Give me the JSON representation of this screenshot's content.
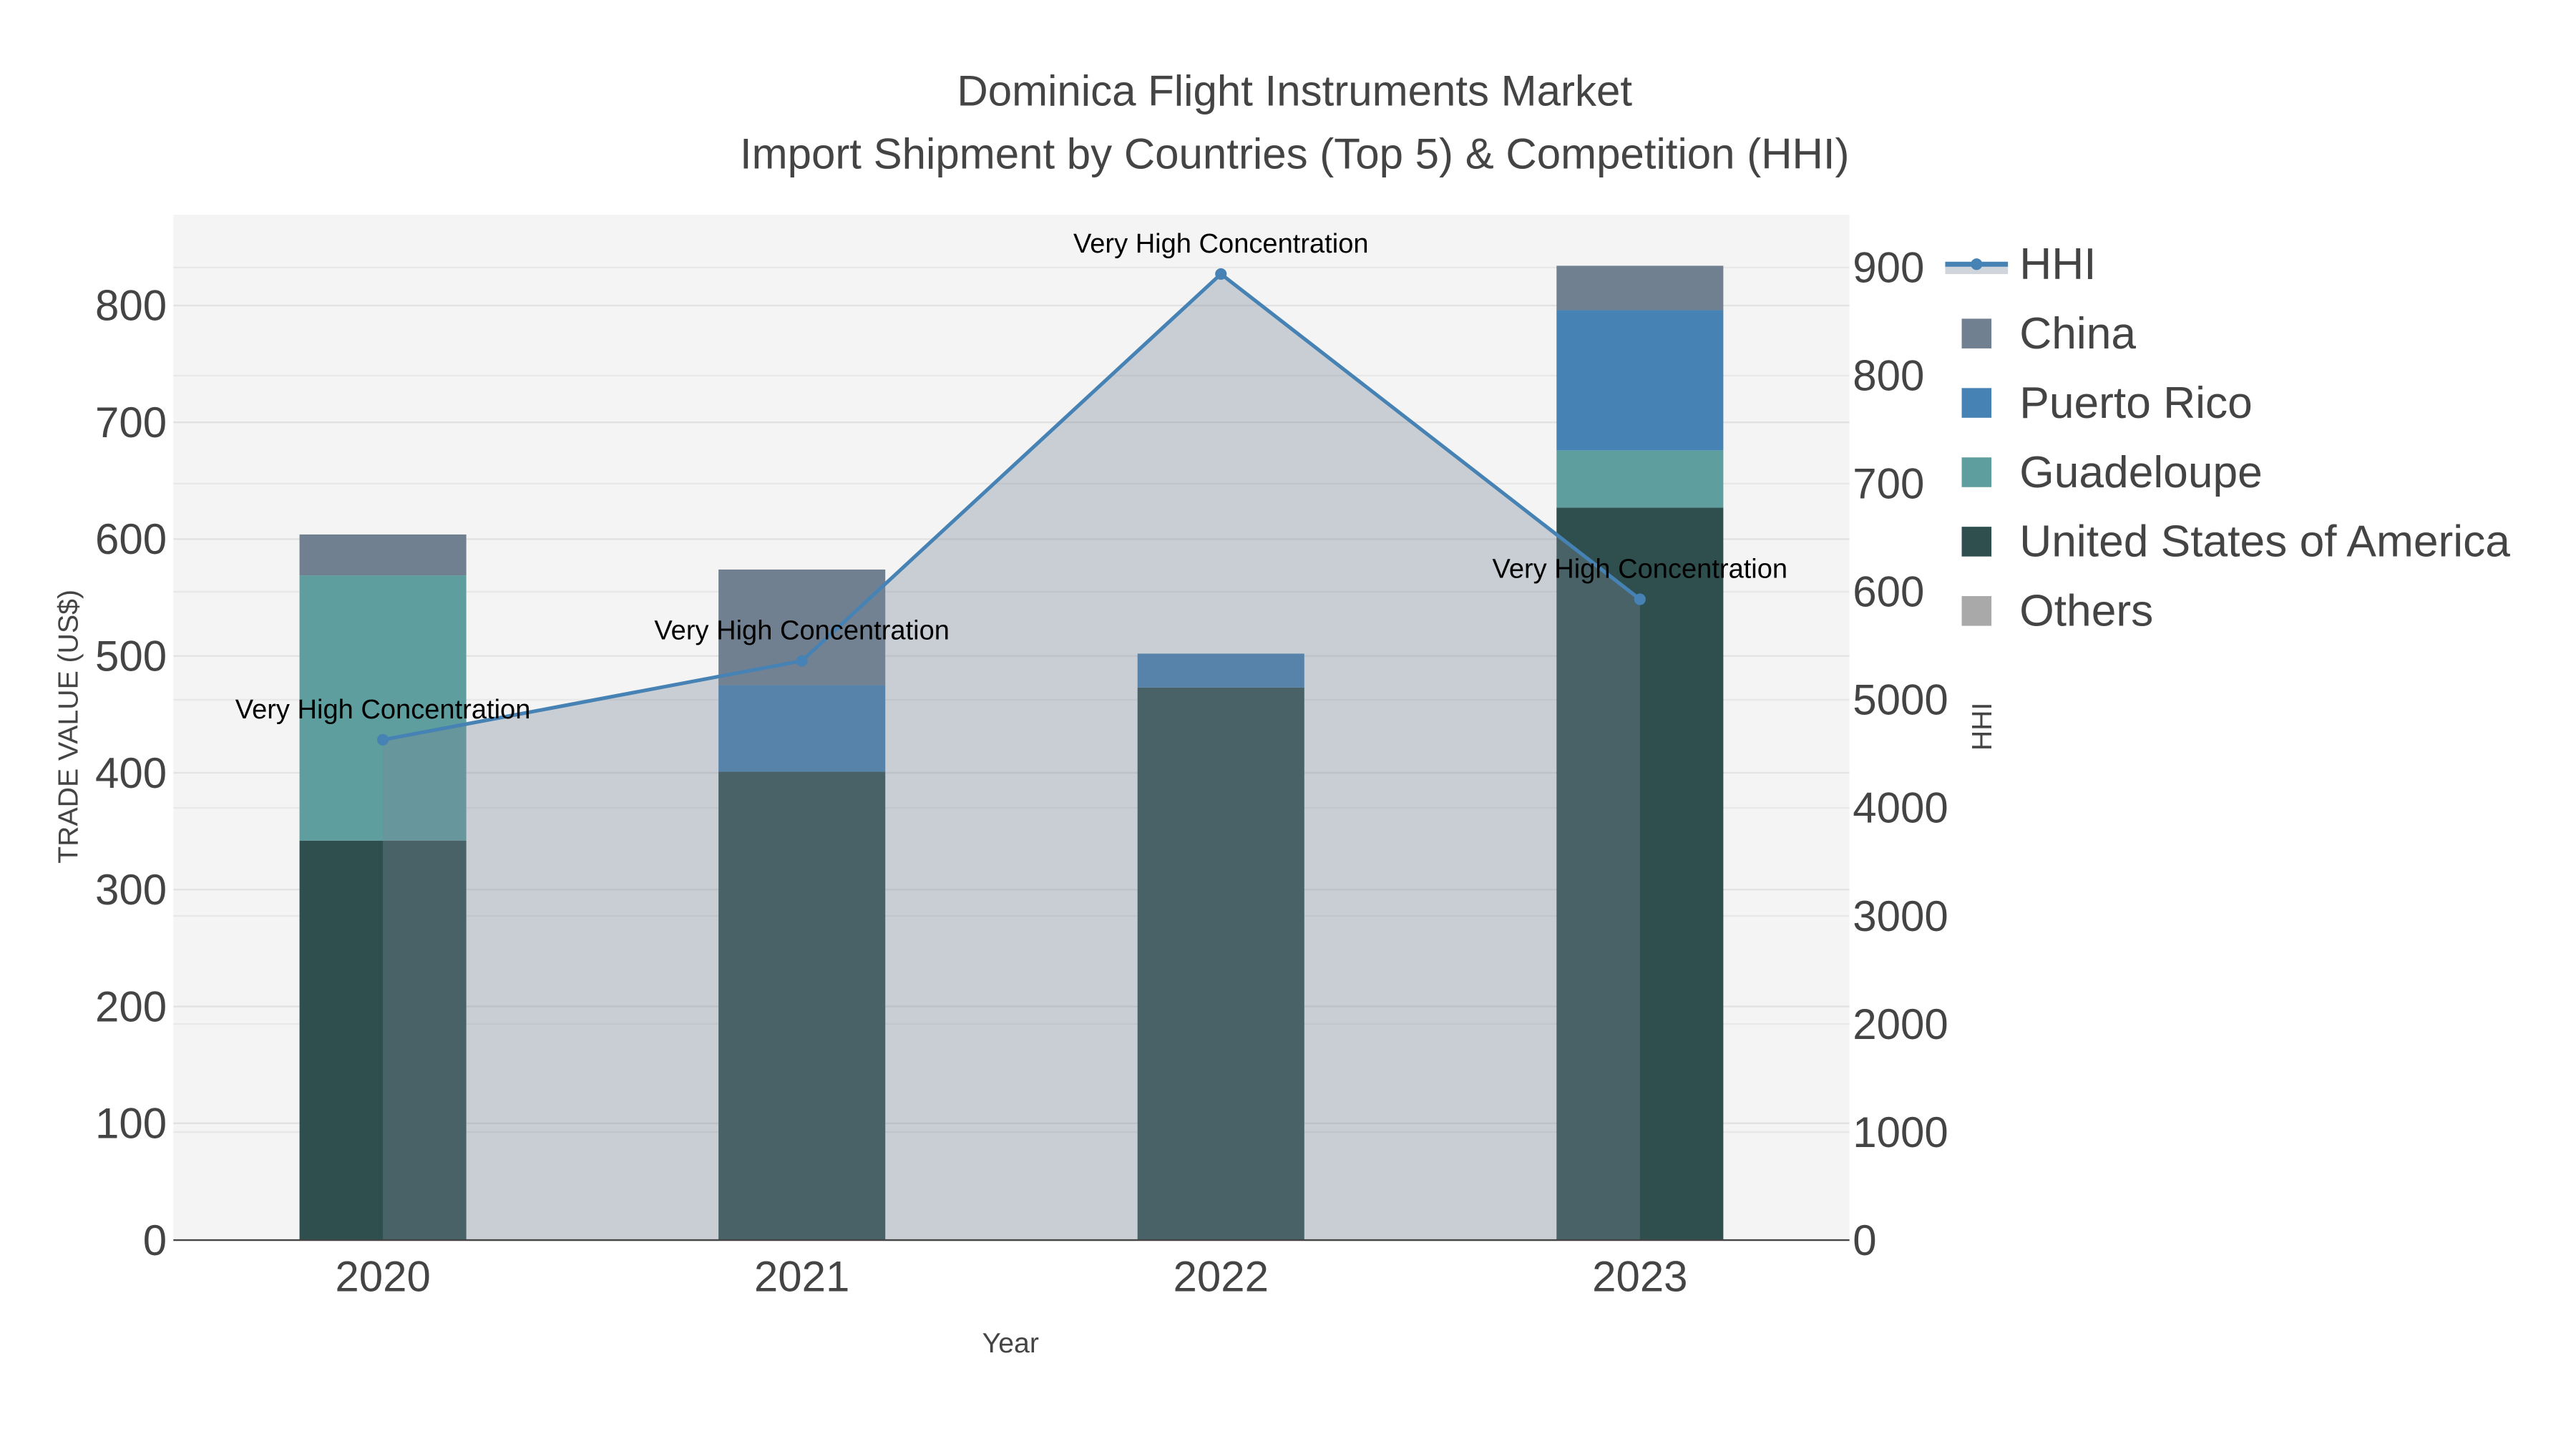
{
  "chart_data": {
    "type": "bar",
    "title": "Dominica Flight Instruments Market",
    "subtitle": "Import Shipment by Countries (Top 5) & Competition (HHI)",
    "xlabel": "Year",
    "ylabel": "TRADE VALUE (US$)",
    "y2label": "HHI",
    "categories": [
      "2020",
      "2021",
      "2022",
      "2023"
    ],
    "ylim": [
      0,
      875
    ],
    "y2lim": [
      0,
      9800
    ],
    "yticks": [
      0,
      100,
      200,
      300,
      400,
      500,
      600,
      700,
      800
    ],
    "y2ticks": [
      0,
      1000,
      2000,
      3000,
      4000,
      5000,
      6000,
      7000,
      8000,
      9000
    ],
    "y2tick_labels": [
      "0",
      "1000",
      "2000",
      "3000",
      "4000",
      "5000",
      "600",
      "700",
      "800",
      "900"
    ],
    "barmode": "stack",
    "series": [
      {
        "name": "United States of America",
        "color": "#2f4f4f",
        "values": [
          342,
          401,
          473,
          627
        ]
      },
      {
        "name": "Guadeloupe",
        "color": "#5f9e9e",
        "values": [
          227,
          0,
          0,
          49
        ]
      },
      {
        "name": "Puerto Rico",
        "color": "#4682b4",
        "values": [
          0,
          74,
          29,
          120
        ]
      },
      {
        "name": "China",
        "color": "#708090",
        "values": [
          35,
          99,
          0,
          38
        ]
      },
      {
        "name": "Others",
        "color": "#a9a9a9",
        "values": [
          0,
          0,
          0,
          0
        ]
      }
    ],
    "hhi": {
      "name": "HHI",
      "color": "#4682b4",
      "values": [
        4630,
        5360,
        8940,
        5930
      ],
      "annotations": [
        "Very High Concentration",
        "Very High Concentration",
        "Very High Concentration",
        "Very High Concentration"
      ]
    },
    "legend": [
      "HHI",
      "China",
      "Puerto Rico",
      "Guadeloupe",
      "United States of America",
      "Others"
    ],
    "legend_position": "right",
    "grid": true
  }
}
